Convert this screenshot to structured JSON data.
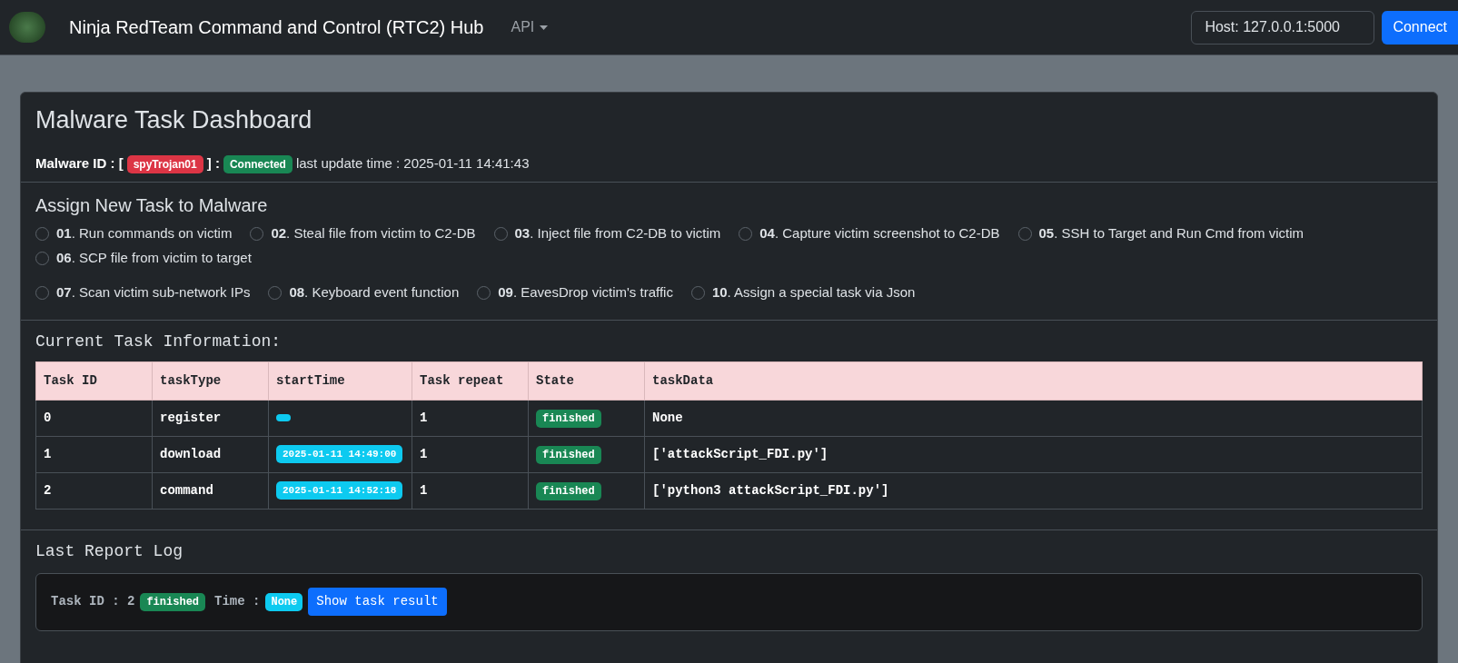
{
  "navbar": {
    "brand": "Ninja RedTeam Command and Control (RTC2) Hub",
    "menu": "API",
    "host_field": {
      "value": "Host: 127.0.0.1:5000"
    },
    "connect_button": "Connect"
  },
  "dashboard": {
    "title": "Malware Task Dashboard",
    "status": {
      "label": "Malware ID : [",
      "id_badge": {
        "text": "spyTrojan01",
        "color": "#dc3545"
      },
      "separator": "] :",
      "state_badge": {
        "text": "Connected",
        "color": "#198754"
      },
      "update": "last update time : 2025-01-11 14:41:43"
    },
    "assign": {
      "title": "Assign New Task to Malware",
      "groups": [
        [
          {
            "label": "**01**. Run commands on victim",
            "selected": false
          },
          {
            "label": "**02**. Steal file from victim to C2-DB",
            "selected": false
          },
          {
            "label": "**03**. Inject file from C2-DB to victim",
            "selected": false
          },
          {
            "label": "**04**. Capture victim screenshot to C2-DB",
            "selected": false
          },
          {
            "label": "**05**. SSH to Target and Run Cmd from victim",
            "selected": false
          },
          {
            "label": "**06**. SCP file from victim to target",
            "selected": false
          }
        ],
        [
          {
            "label": "**07**. Scan victim sub-network IPs",
            "selected": false
          },
          {
            "label": "**08**. Keyboard event function",
            "selected": false
          },
          {
            "label": "**09**. EavesDrop victim's traffic",
            "selected": false
          },
          {
            "label": "**10**. Assign a special task via Json",
            "selected": false
          }
        ]
      ]
    },
    "current_task": {
      "title": "Current Task Information:",
      "table": {
        "columns": [
          "Task ID",
          "taskType",
          "startTime",
          "Task repeat",
          "State",
          "taskData"
        ],
        "rows": [
          {
            "task_id": "0",
            "task_type": "register",
            "start_time": "",
            "repeat": "1",
            "state": {
              "text": "finished",
              "color": "#198754"
            },
            "task_data": "None"
          },
          {
            "task_id": "1",
            "task_type": "download",
            "start_time": "2025-01-11 14:49:00",
            "repeat": "1",
            "state": {
              "text": "finished",
              "color": "#198754"
            },
            "task_data": "['attackScript_FDI.py']"
          },
          {
            "task_id": "2",
            "task_type": "command",
            "start_time": "2025-01-11 14:52:18",
            "repeat": "1",
            "state": {
              "text": "finished",
              "color": "#198754"
            },
            "task_data": "['python3 attackScript_FDI.py']"
          }
        ]
      }
    },
    "last_report": {
      "title": "Last Report Log",
      "task_label": "Task ID : 2",
      "state_badge": {
        "text": "finished",
        "color": "#198754"
      },
      "time_label": "Time :",
      "time_badge": "None",
      "result_button": "Show task result"
    }
  }
}
